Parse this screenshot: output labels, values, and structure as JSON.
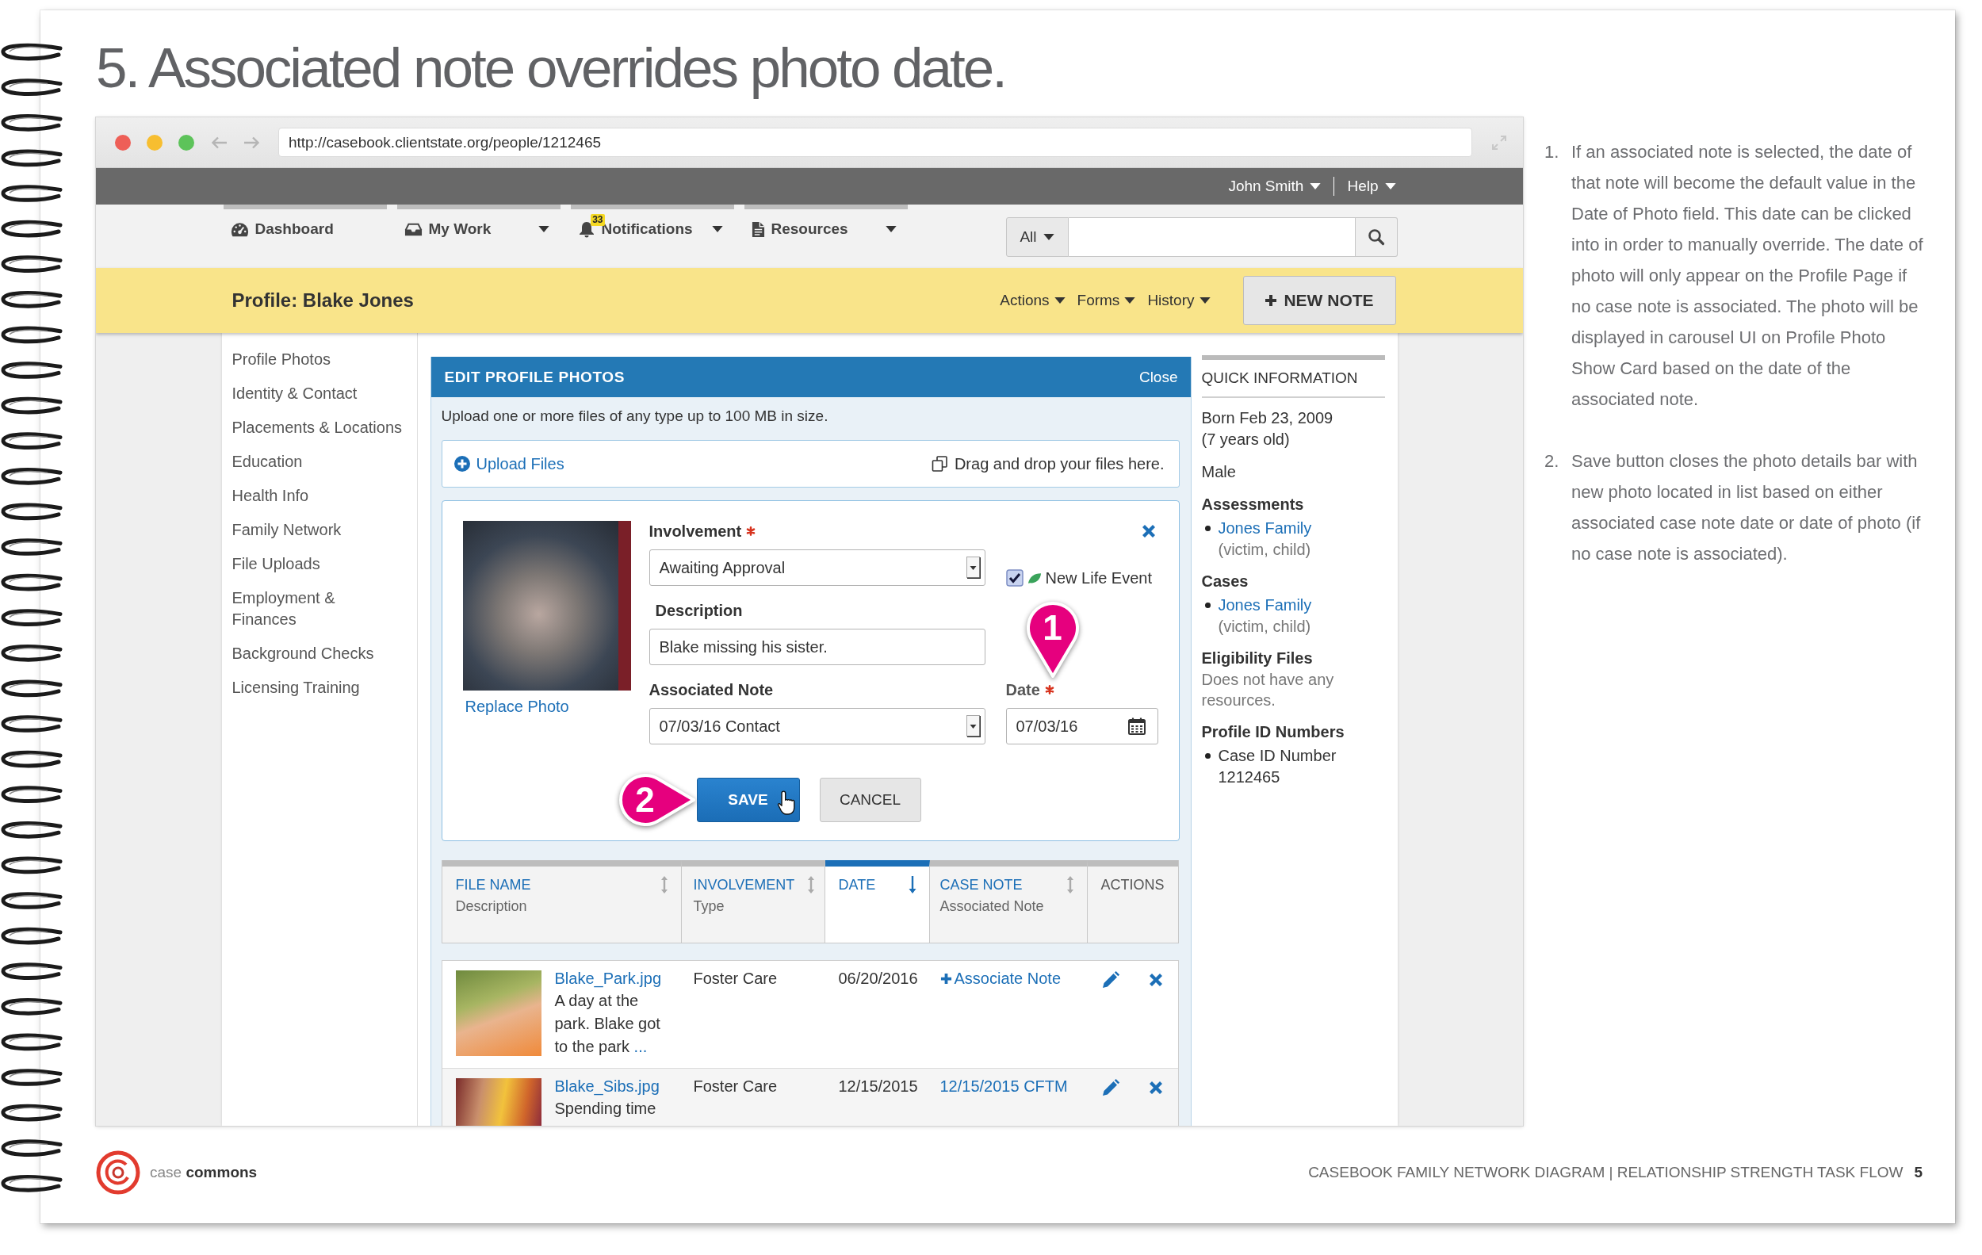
{
  "page": {
    "title": "5. Associated note overrides photo date."
  },
  "browser": {
    "url": "http://casebook.clientstate.org/people/1212465"
  },
  "top_bar": {
    "menus": [
      {
        "label": "John Smith"
      },
      {
        "label": "Help"
      }
    ]
  },
  "nav": {
    "tabs": [
      {
        "label": "Dashboard",
        "kind": "dashboard",
        "dropdown": false
      },
      {
        "label": "My Work",
        "kind": "inbox",
        "dropdown": true
      },
      {
        "label": "Notifications",
        "kind": "alerts",
        "dropdown": true,
        "badge": "33"
      },
      {
        "label": "Resources",
        "kind": "document",
        "dropdown": true
      }
    ],
    "search": {
      "scope": "All"
    }
  },
  "profile_bar": {
    "title": "Profile: Blake Jones",
    "menus": [
      "Actions",
      "Forms",
      "History"
    ],
    "button": "NEW NOTE"
  },
  "sidebar": {
    "items": [
      "Profile Photos",
      "Identity & Contact",
      "Placements & Locations",
      "Education",
      "Health Info",
      "Family Network",
      "File Uploads",
      "Employment &\nFinances",
      "Background Checks",
      "Licensing Training"
    ]
  },
  "edit_panel": {
    "title": "EDIT PROFILE PHOTOS",
    "close": "Close",
    "hint": "Upload one or more files of any type up to 100 MB in size.",
    "upload": {
      "link": "Upload Files",
      "drop_hint": "Drag and drop your files here."
    },
    "form": {
      "replace_link": "Replace Photo",
      "fields": [
        {
          "kind": "select",
          "label": "Involvement",
          "required": true,
          "value": "Awaiting Approval"
        },
        {
          "kind": "text",
          "label": "Description",
          "required": false,
          "value": "Blake missing his sister."
        },
        {
          "kind": "select",
          "label": "Associated Note",
          "required": false,
          "value": "07/03/16 Contact"
        }
      ],
      "new_life_event": {
        "label": "New Life Event",
        "checked": true
      },
      "date": {
        "label": "Date",
        "required": true,
        "value": "07/03/16",
        "callout": "1"
      },
      "buttons": [
        {
          "label": "SAVE",
          "kind": "primary",
          "callout": "2"
        },
        {
          "label": "CANCEL",
          "kind": "secondary"
        }
      ]
    },
    "table": {
      "columns": [
        {
          "title": "FILE NAME",
          "subtitle": "Description",
          "sortable": true,
          "selected": false
        },
        {
          "title": "INVOLVEMENT",
          "subtitle": "Type",
          "sortable": true,
          "selected": false
        },
        {
          "title": "DATE",
          "sortable": true,
          "selected": true
        },
        {
          "title": "CASE NOTE",
          "subtitle": "Associated Note",
          "sortable": true,
          "selected": false
        },
        {
          "title": "ACTIONS",
          "sortable": false,
          "selected": false
        }
      ],
      "rows": [
        {
          "file_name": "Blake_Park.jpg",
          "description": "A day at the park. Blake got to the park",
          "more": "...",
          "involvement": "Foster Care",
          "date": "06/20/2016",
          "case_note": {
            "kind": "action",
            "text": "Associate Note"
          }
        },
        {
          "file_name": "Blake_Sibs.jpg",
          "description": "Spending time",
          "involvement": "Foster Care",
          "date": "12/15/2015",
          "case_note": {
            "kind": "link",
            "text": "12/15/2015 CFTM"
          }
        }
      ]
    }
  },
  "quick_info": {
    "title": "QUICK INFORMATION",
    "sections": [
      {
        "kind": "plain",
        "lines": [
          "Born Feb 23, 2009",
          "(7 years old)"
        ]
      },
      {
        "kind": "plain",
        "lines": [
          "Male"
        ]
      },
      {
        "kind": "links",
        "heading": "Assessments",
        "items": [
          {
            "link": "Jones Family",
            "note": "(victim, child)"
          }
        ]
      },
      {
        "kind": "links",
        "heading": "Cases",
        "items": [
          {
            "link": "Jones Family",
            "note": "(victim, child)"
          }
        ]
      },
      {
        "kind": "text",
        "heading": "Eligibility Files",
        "text": "Does not have any resources."
      },
      {
        "kind": "ids",
        "heading": "Profile ID Numbers",
        "items": [
          {
            "label": "Case ID Number",
            "value": "1212465"
          }
        ]
      }
    ]
  },
  "notes": [
    {
      "number": "1.",
      "text": "If an associated note is selected, the date of that note will become the default value in the Date of Photo field. This date can be clicked into in order to manually override. The date of photo will only appear on the Profile Page if no case note is associated. The photo will be displayed in carousel UI on Profile Photo Show Card based on the date of the associated note."
    },
    {
      "number": "2.",
      "text": "Save button closes the photo details bar with new photo located in list based on either associated case note date or date of photo (if no case note is associated)."
    }
  ],
  "footer": {
    "brand": "case **commons**",
    "title": "CASEBOOK FAMILY NETWORK DIAGRAM | RELATIONSHIP STRENGTH TASK FLOW",
    "page_number": "5"
  }
}
